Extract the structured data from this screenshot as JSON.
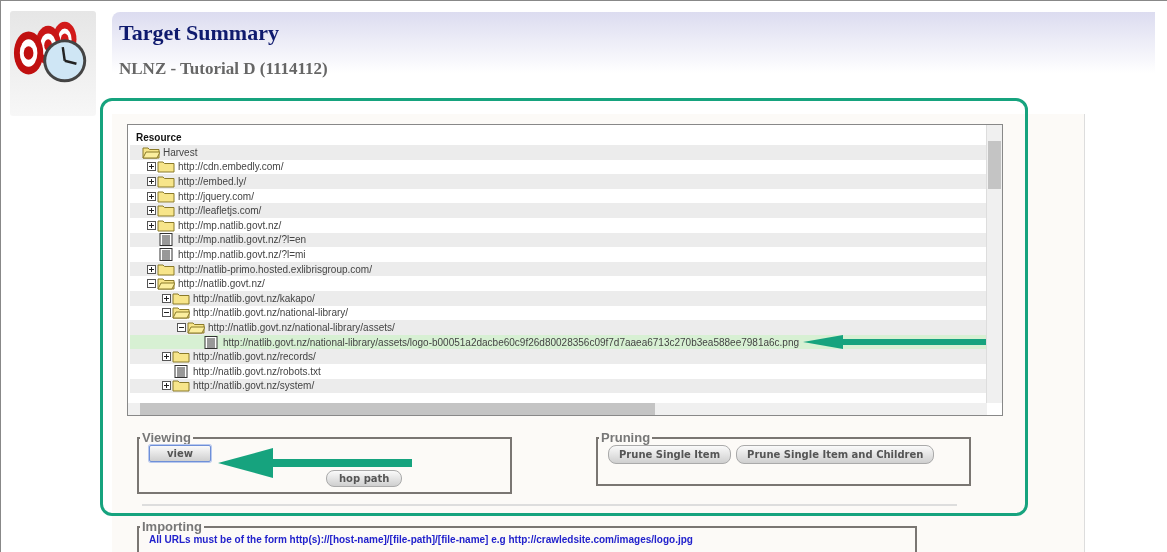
{
  "header": {
    "title": "Target Summary",
    "subtitle": "NLNZ - Tutorial D (1114112)"
  },
  "tree": {
    "column": "Resource",
    "items": [
      {
        "label": "Harvest",
        "kind": "folder",
        "expanded": true,
        "selected": false,
        "children": [
          {
            "label": "http://cdn.embedly.com/",
            "kind": "folder",
            "expanded": false,
            "selected": false
          },
          {
            "label": "http://embed.ly/",
            "kind": "folder",
            "expanded": false,
            "selected": false
          },
          {
            "label": "http://jquery.com/",
            "kind": "folder",
            "expanded": false,
            "selected": false
          },
          {
            "label": "http://leafletjs.com/",
            "kind": "folder",
            "expanded": false,
            "selected": false
          },
          {
            "label": "http://mp.natlib.govt.nz/",
            "kind": "folder",
            "expanded": false,
            "selected": false
          },
          {
            "label": "http://mp.natlib.govt.nz/?l=en",
            "kind": "file",
            "selected": false
          },
          {
            "label": "http://mp.natlib.govt.nz/?l=mi",
            "kind": "file",
            "selected": false
          },
          {
            "label": "http://natlib-primo.hosted.exlibrisgroup.com/",
            "kind": "folder",
            "expanded": false,
            "selected": false
          },
          {
            "label": "http://natlib.govt.nz/",
            "kind": "folder",
            "expanded": true,
            "selected": false,
            "children": [
              {
                "label": "http://natlib.govt.nz/kakapo/",
                "kind": "folder",
                "expanded": false,
                "selected": false
              },
              {
                "label": "http://natlib.govt.nz/national-library/",
                "kind": "folder",
                "expanded": true,
                "selected": false,
                "children": [
                  {
                    "label": "http://natlib.govt.nz/national-library/assets/",
                    "kind": "folder",
                    "expanded": true,
                    "selected": false,
                    "children": [
                      {
                        "label": "http://natlib.govt.nz/national-library/assets/logo-b00051a2dacbe60c9f26d80028356c09f7d7aaea6713c270b3ea588ee7981a6c.png",
                        "kind": "file",
                        "selected": true
                      }
                    ]
                  }
                ]
              },
              {
                "label": "http://natlib.govt.nz/records/",
                "kind": "folder",
                "expanded": false,
                "selected": false
              },
              {
                "label": "http://natlib.govt.nz/robots.txt",
                "kind": "file",
                "selected": false
              },
              {
                "label": "http://natlib.govt.nz/system/",
                "kind": "folder",
                "expanded": false,
                "selected": false
              }
            ]
          }
        ]
      }
    ]
  },
  "viewing": {
    "legend": "Viewing",
    "buttons": [
      {
        "label": "view",
        "focused": true
      },
      {
        "label": "hop path",
        "focused": false
      }
    ]
  },
  "pruning": {
    "legend": "Pruning",
    "buttons": [
      "Prune Single Item",
      "Prune Single Item and Children"
    ]
  },
  "importing": {
    "legend": "Importing",
    "note": "All URLs must be of the form http(s)://[host-name]/[file-path]/[file-name] e.g http://crawledsite.com/images/logo.jpg"
  }
}
